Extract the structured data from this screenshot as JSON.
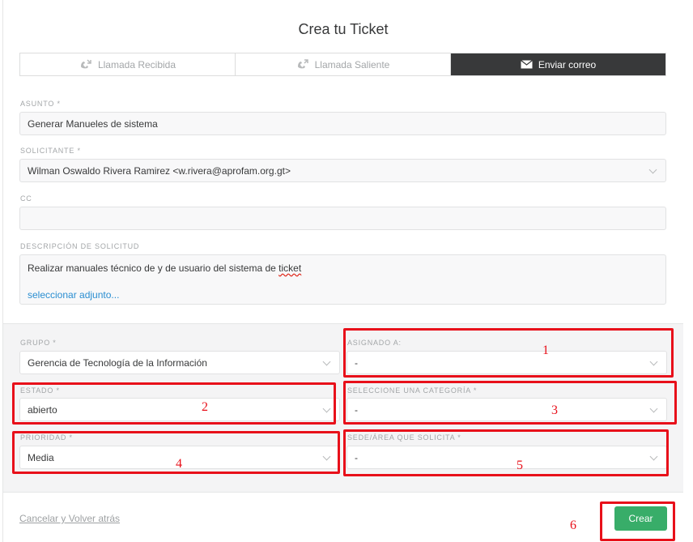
{
  "title": "Crea tu Ticket",
  "tabs": [
    {
      "label": "Llamada Recibida",
      "icon": "phone-incoming-icon"
    },
    {
      "label": "Llamada Saliente",
      "icon": "phone-outgoing-icon"
    },
    {
      "label": "Enviar correo",
      "icon": "envelope-icon",
      "active": true
    }
  ],
  "fields": {
    "asunto": {
      "label": "ASUNTO *",
      "value": "Generar Manueles de sistema"
    },
    "solicitante": {
      "label": "SOLICITANTE *",
      "value": "Wilman Oswaldo Rivera Ramirez <w.rivera@aprofam.org.gt>"
    },
    "cc": {
      "label": "CC",
      "value": ""
    },
    "descripcion": {
      "label": "DESCRIPCIÓN DE SOLICITUD",
      "text_before": "Realizar manuales técnico de y de usuario  del sistema de ",
      "misspelled": "ticket",
      "attach_link": "seleccionar adjunto..."
    }
  },
  "selects": {
    "grupo": {
      "label": "GRUPO *",
      "value": "Gerencia de Tecnología de la Información"
    },
    "asignado": {
      "label": "ASIGNADO A:",
      "value": "-"
    },
    "estado": {
      "label": "ESTADO *",
      "value": "abierto"
    },
    "categoria": {
      "label": "SELECCIONE UNA CATEGORÍA *",
      "value": "-"
    },
    "prioridad": {
      "label": "PRIORIDAD *",
      "value": "Media"
    },
    "sede": {
      "label": "SEDE/ÁREA QUE SOLICITA *",
      "value": "-"
    }
  },
  "annotations": [
    "1",
    "2",
    "3",
    "4",
    "5",
    "6"
  ],
  "footer": {
    "cancel_label": "Cancelar y Volver atrás",
    "create_label": "Crear"
  },
  "colors": {
    "accent_dark": "#38393a",
    "create_green": "#38ad69",
    "link_blue": "#2a8ed1",
    "annotation_red": "#e8101a"
  }
}
